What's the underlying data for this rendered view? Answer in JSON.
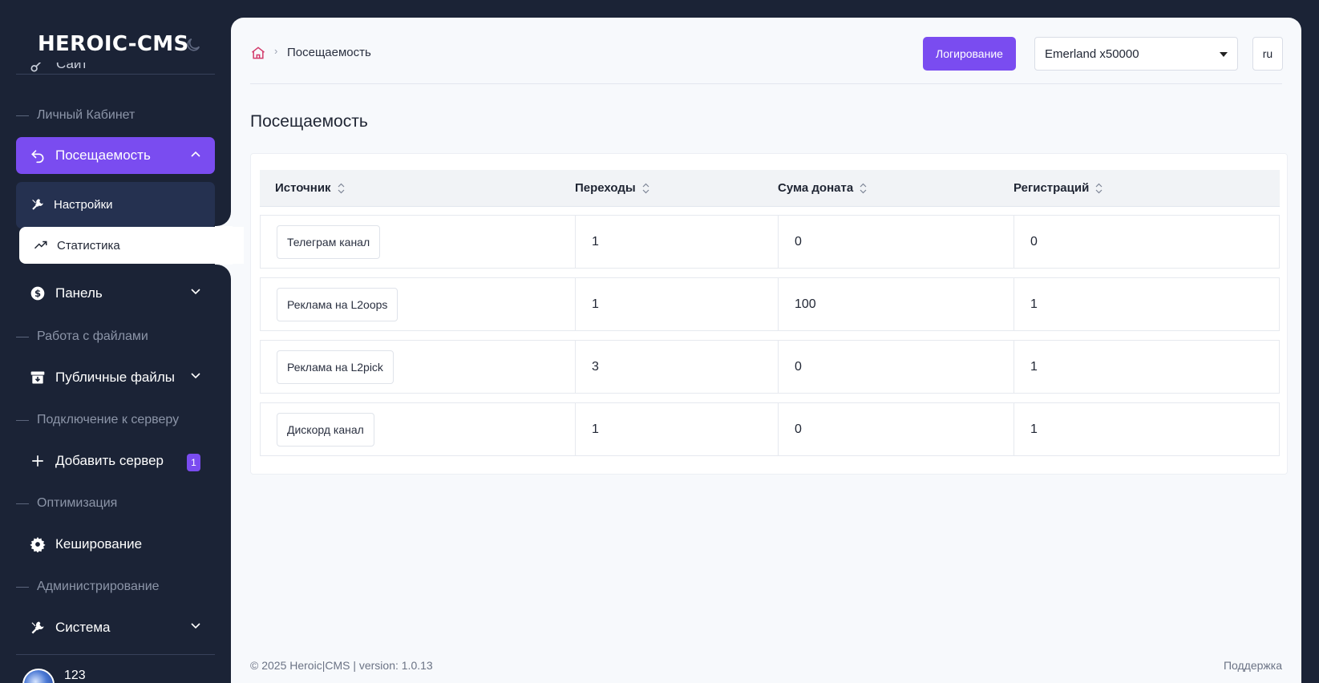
{
  "brand": "HEROIC-CMS",
  "sidebar": {
    "cut_item_label": "Сайт",
    "sections": {
      "cabinet": "Личный Кабинет",
      "files": "Работа с файлами",
      "server": "Подключение к серверу",
      "optimization": "Оптимизация",
      "admin": "Администрирование"
    },
    "items": {
      "attendance": "Посещаемость",
      "settings": "Настройки",
      "statistics": "Статистика",
      "panel": "Панель",
      "public_files": "Публичные файлы",
      "add_server": "Добавить сервер",
      "add_server_badge": "1",
      "caching": "Кеширование",
      "system": "Система"
    },
    "user": {
      "name": "123"
    }
  },
  "header": {
    "breadcrumb": "Посещаемость",
    "log_button": "Логирование",
    "server_select": "Emerland x50000",
    "lang": "ru"
  },
  "page": {
    "title": "Посещаемость"
  },
  "table": {
    "columns": [
      "Источник",
      "Переходы",
      "Сума доната",
      "Регистраций"
    ],
    "rows": [
      [
        "Телеграм канал",
        "1",
        "0",
        "0"
      ],
      [
        "Реклама на L2oops",
        "1",
        "100",
        "1"
      ],
      [
        "Реклама на L2pick",
        "3",
        "0",
        "1"
      ],
      [
        "Дискорд канал",
        "1",
        "0",
        "1"
      ]
    ]
  },
  "footer": {
    "copyright": "© 2025 Heroic|CMS | version: 1.0.13",
    "support": "Поддержка"
  },
  "colors": {
    "accent": "#7a4cf0",
    "sidebar_bg": "#1b2336",
    "main_bg": "#f7f9fc"
  }
}
